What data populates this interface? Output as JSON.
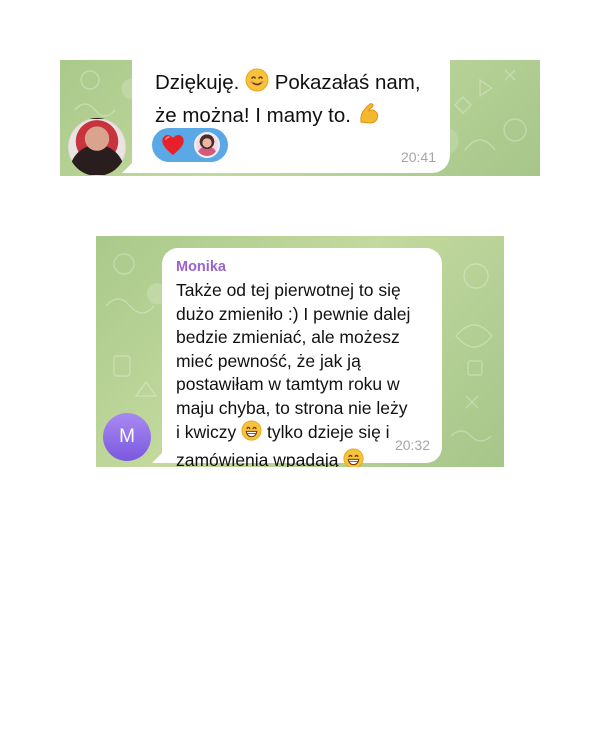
{
  "conversation_1": {
    "message": {
      "text_part_1": "Dziękuję. ",
      "text_part_2": " Pokazałaś nam,\nże można! I mamy to. ",
      "emoji_1": "smiling-face-icon",
      "emoji_2": "flexed-biceps-icon",
      "time": "20:41",
      "reactions": [
        {
          "type": "heart",
          "icon": "red-heart-icon"
        }
      ]
    },
    "avatar": {
      "kind": "photo"
    }
  },
  "conversation_2": {
    "message": {
      "sender": "Monika",
      "text_part_1": "Także od tej pierwotnej to się\ndużo zmieniło :) I pewnie dalej\nbedzie zmieniać, ale możesz\nmieć pewność, że jak ją\npostawiłam w tamtym roku w\nmaju chyba, to strona nie leży\ni kwiczy ",
      "text_part_2": " tylko dzieje się i\nzamówienia wpadają ",
      "emoji_1": "grinning-face-icon",
      "emoji_2": "grinning-face-icon",
      "time": "20:32"
    },
    "avatar": {
      "initial": "M",
      "color": "#8b6ae8"
    }
  },
  "colors": {
    "chat_background": "#b8d39a",
    "sender_name": "#9a63c8",
    "reaction_pill": "#5aa8e6",
    "time_text": "#a3a6a8"
  }
}
